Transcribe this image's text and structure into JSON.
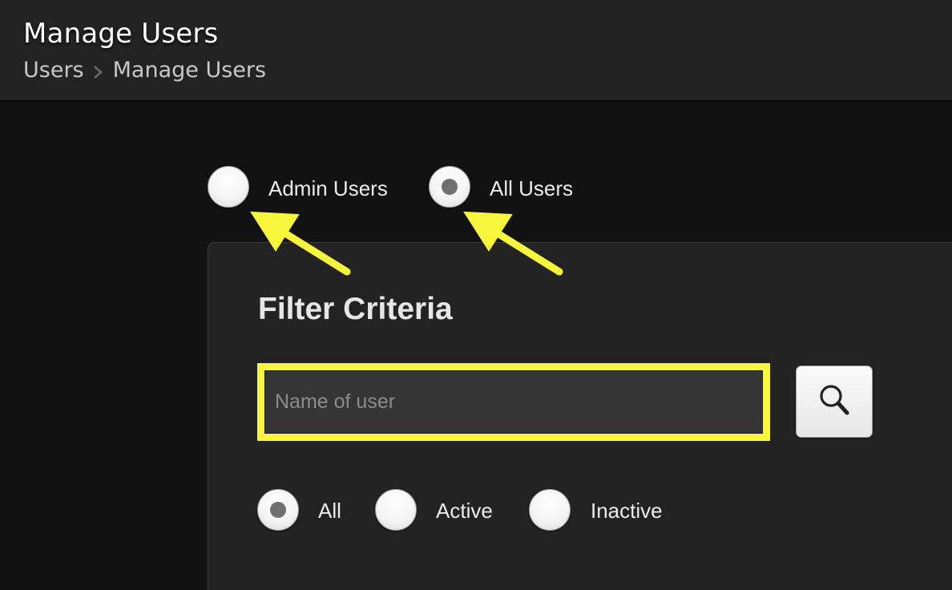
{
  "header": {
    "title": "Manage Users",
    "breadcrumb": [
      "Users",
      "Manage Users"
    ]
  },
  "user_type": {
    "options": [
      {
        "label": "Admin Users",
        "checked": false
      },
      {
        "label": "All Users",
        "checked": true
      }
    ]
  },
  "filter": {
    "title": "Filter Criteria",
    "search_placeholder": "Name of user",
    "search_value": "",
    "search_icon": "magnifier-icon",
    "status_options": [
      {
        "label": "All",
        "checked": true
      },
      {
        "label": "Active",
        "checked": false
      },
      {
        "label": "Inactive",
        "checked": false
      }
    ]
  },
  "colors": {
    "highlight": "#f7f53c",
    "background": "#121212",
    "header_bg": "#232323",
    "panel_bg": "#232323"
  }
}
